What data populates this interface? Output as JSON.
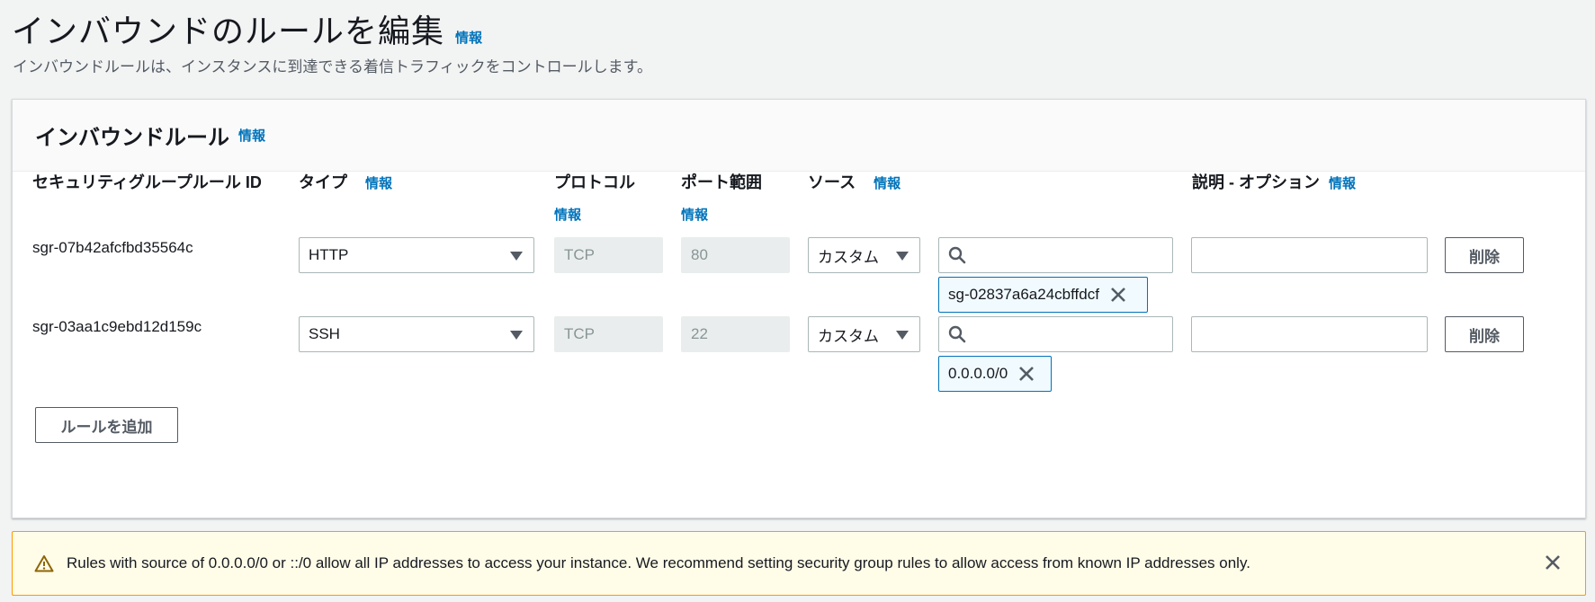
{
  "page": {
    "title": "インバウンドのルールを編集",
    "info_label": "情報",
    "description": "インバウンドルールは、インスタンスに到達できる着信トラフィックをコントロールします。"
  },
  "panel": {
    "title": "インバウンドルール",
    "info_label": "情報",
    "columns": {
      "rule_id": "セキュリティグループルール ID",
      "type": "タイプ",
      "protocol": "プロトコル",
      "port_range": "ポート範囲",
      "source": "ソース",
      "description": "説明 - オプション",
      "info_label": "情報"
    },
    "rules": [
      {
        "rule_id": "sgr-07b42afcfbd35564c",
        "type": "HTTP",
        "protocol": "TCP",
        "port": "80",
        "source_type": "カスタム",
        "source_search": "",
        "source_token": "sg-02837a6a24cbffdcf",
        "description": "",
        "delete_label": "削除"
      },
      {
        "rule_id": "sgr-03aa1c9ebd12d159c",
        "type": "SSH",
        "protocol": "TCP",
        "port": "22",
        "source_type": "カスタム",
        "source_search": "",
        "source_token": "0.0.0.0/0",
        "description": "",
        "delete_label": "削除"
      }
    ],
    "add_rule_label": "ルールを追加"
  },
  "alert": {
    "text": "Rules with source of 0.0.0.0/0 or ::/0 allow all IP addresses to access your instance. We recommend setting security group rules to allow access from known IP addresses only.",
    "icon": "warning-icon",
    "close_icon": "close-icon"
  },
  "colors": {
    "link": "#0073bb",
    "warning_border": "#ff9900",
    "warning_bg": "#fffce8"
  }
}
